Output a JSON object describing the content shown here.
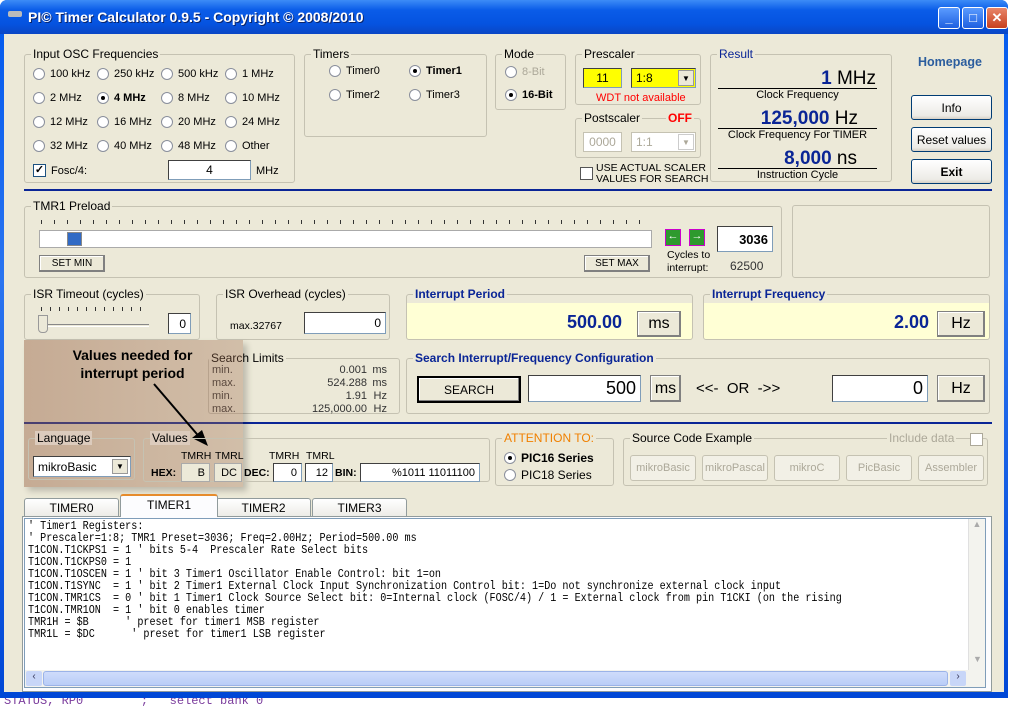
{
  "window": {
    "title": "PI© Timer Calculator 0.9.5 - Copyright © 2008/2010",
    "minimize": "_",
    "maximize": "□",
    "close": "✕"
  },
  "osc": {
    "label": "Input OSC Frequencies",
    "options": [
      "100 kHz",
      "250 kHz",
      "500 kHz",
      "1 MHz",
      "2 MHz",
      "4 MHz",
      "8 MHz",
      "10 MHz",
      "12 MHz",
      "16 MHz",
      "20 MHz",
      "24 MHz",
      "32 MHz",
      "40 MHz",
      "48 MHz",
      "Other"
    ],
    "selected": "4 MHz",
    "fosc_label": "Fosc/4:",
    "fosc_checked": true,
    "value": "4",
    "unit": "MHz"
  },
  "timers": {
    "label": "Timers",
    "options": [
      "Timer0",
      "Timer1",
      "Timer2",
      "Timer3"
    ],
    "selected": "Timer1"
  },
  "mode": {
    "label": "Mode",
    "options": [
      "8-Bit",
      "16-Bit"
    ],
    "selected": "16-Bit"
  },
  "prescaler": {
    "label": "Prescaler",
    "bits": "11",
    "ratio": "1:8",
    "warning": "WDT not available"
  },
  "postscaler": {
    "label": "Postscaler",
    "status": "OFF",
    "bits": "0000",
    "ratio": "1:1"
  },
  "use_actual": {
    "label1": "USE ACTUAL SCALER",
    "label2": "VALUES FOR SEARCH",
    "checked": false
  },
  "result": {
    "label": "Result",
    "clock_value": "1",
    "clock_unit": "MHz",
    "clock_label": "Clock Frequency",
    "timer_value": "125,000",
    "timer_unit": "Hz",
    "timer_label": "Clock Frequency For TIMER",
    "cycle_value": "8,000",
    "cycle_unit": "ns",
    "cycle_label": "Instruction Cycle"
  },
  "side": {
    "homepage": "Homepage",
    "info": "Info",
    "reset": "Reset values",
    "exit": "Exit"
  },
  "preload": {
    "label": "TMR1 Preload",
    "value": "3036",
    "set_min": "SET MIN",
    "set_max": "SET MAX",
    "cycles_label1": "Cycles to",
    "cycles_label2": "interrupt:",
    "cycles": "62500",
    "slider_fraction": 0.046
  },
  "isr_timeout": {
    "label": "ISR Timeout (cycles)",
    "value": "0"
  },
  "isr_overhead": {
    "label": "ISR Overhead  (cycles)",
    "max": "max.32767",
    "value": "0"
  },
  "period": {
    "label": "Interrupt Period",
    "value": "500.00",
    "unit": "ms"
  },
  "frequency": {
    "label": "Interrupt Frequency",
    "value": "2.00",
    "unit": "Hz"
  },
  "limits": {
    "label": "Search Limits",
    "rows": [
      [
        "min.",
        "0.001",
        "ms"
      ],
      [
        "max.",
        "524.288",
        "ms"
      ],
      [
        "min.",
        "1.91",
        "Hz"
      ],
      [
        "max.",
        "125,000.00",
        "Hz"
      ]
    ]
  },
  "search": {
    "label": "Search Interrupt/Frequency Configuration",
    "button": "SEARCH",
    "period": "500",
    "period_unit": "ms",
    "or": "<<-  OR  ->>",
    "freq": "0",
    "freq_unit": "Hz"
  },
  "annotation": {
    "text1": "Values needed for",
    "text2": "interrupt period"
  },
  "language": {
    "label": "Language",
    "value": "mikroBasic"
  },
  "values": {
    "label": "Values",
    "tmrh": "TMRH",
    "tmrl": "TMRL",
    "hex": "HEX:",
    "hex_h": "B",
    "hex_l": "DC",
    "dec": "DEC:",
    "dec_h": "0",
    "dec_l": "12",
    "bin": "BIN:",
    "bin_value": "%1011 11011100"
  },
  "attention": {
    "label": "ATTENTION TO:",
    "options": [
      "PIC16 Series",
      "PIC18 Series"
    ],
    "selected": "PIC16 Series"
  },
  "source": {
    "label": "Source Code Example",
    "include": "Include data",
    "buttons": [
      "mikroBasic",
      "mikroPascal",
      "mikroC",
      "PicBasic",
      "Assembler"
    ]
  },
  "tabs": [
    "TIMER0",
    "TIMER1",
    "TIMER2",
    "TIMER3"
  ],
  "active_tab": "TIMER1",
  "code": [
    "' Timer1 Registers:",
    "' Prescaler=1:8; TMR1 Preset=3036; Freq=2.00Hz; Period=500.00 ms",
    "T1CON.T1CKPS1 = 1 ' bits 5-4  Prescaler Rate Select bits",
    "T1CON.T1CKPS0 = 1",
    "T1CON.T1OSCEN = 1 ' bit 3 Timer1 Oscillator Enable Control: bit 1=on",
    "T1CON.T1SYNC  = 1 ' bit 2 Timer1 External Clock Input Synchronization Control bit: 1=Do not synchronize external clock input",
    "T1CON.TMR1CS  = 0 ' bit 1 Timer1 Clock Source Select bit: 0=Internal clock (FOSC/4) / 1 = External clock from pin T1CKI (on the rising",
    "T1CON.TMR1ON  = 1 ' bit 0 enables timer",
    "TMR1H = $B      ' preset for timer1 MSB register",
    "TMR1L = $DC      ' preset for timer1 LSB register"
  ],
  "background_text": "STATUS, RP0        ;   select bank 0"
}
